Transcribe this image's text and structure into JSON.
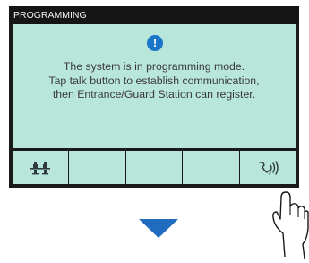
{
  "header": {
    "title": "PROGRAMMING"
  },
  "message": {
    "icon": "info-icon",
    "lines": [
      "The system is in programming mode.",
      "Tap talk button to establish communication,",
      "then Entrance/Guard Station can register."
    ]
  },
  "buttons": [
    {
      "icon": "network-icon"
    },
    {
      "icon": ""
    },
    {
      "icon": ""
    },
    {
      "icon": ""
    },
    {
      "icon": "talk-icon"
    }
  ],
  "colors": {
    "screen": "#b8e6da",
    "titlebar": "#151515",
    "accent": "#1b76c9",
    "arrow": "#1f6cc0"
  }
}
